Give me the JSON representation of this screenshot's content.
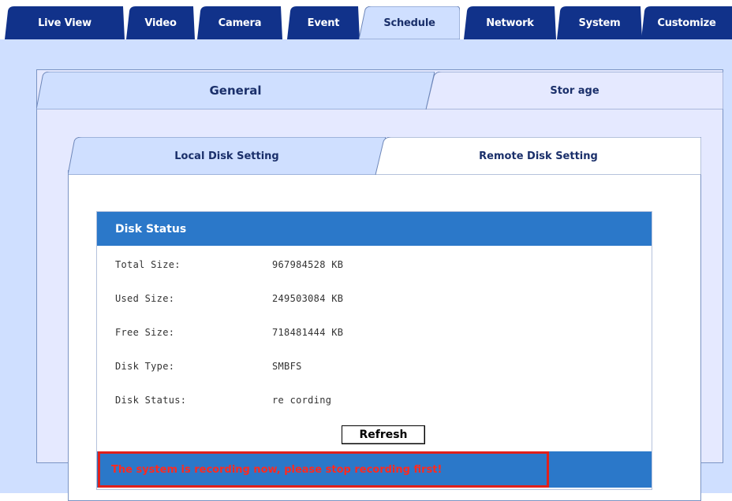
{
  "nav": {
    "tabs": [
      {
        "label": "Live View"
      },
      {
        "label": "Video"
      },
      {
        "label": "Camera"
      },
      {
        "label": "Event"
      },
      {
        "label": "Schedule"
      },
      {
        "label": "Network"
      },
      {
        "label": "System"
      },
      {
        "label": "Customize"
      }
    ],
    "active": "Schedule"
  },
  "storage_tabs": {
    "general": "General",
    "storage": "Stor age",
    "active": "Storage"
  },
  "disk_tabs": {
    "local": "Local Disk Setting",
    "remote": "Remote Disk Setting",
    "active": "Remote Disk Setting"
  },
  "disk_status": {
    "title": "Disk Status",
    "rows": [
      {
        "label": "Total Size:",
        "value": "967984528 KB"
      },
      {
        "label": "Used Size:",
        "value": "249503084 KB"
      },
      {
        "label": "Free Size:",
        "value": "718481444 KB"
      },
      {
        "label": "Disk Type:",
        "value": "SMBFS"
      },
      {
        "label": "Disk Status:",
        "value": "re cording"
      }
    ],
    "refresh_label": "Refresh",
    "alert": "The system is recording now, please stop recording first!"
  },
  "colors": {
    "nav_tab": "#11328a",
    "header_blue": "#2b78c9",
    "alert_red": "#ff2a1f",
    "main_bg": "#cfdfff"
  }
}
